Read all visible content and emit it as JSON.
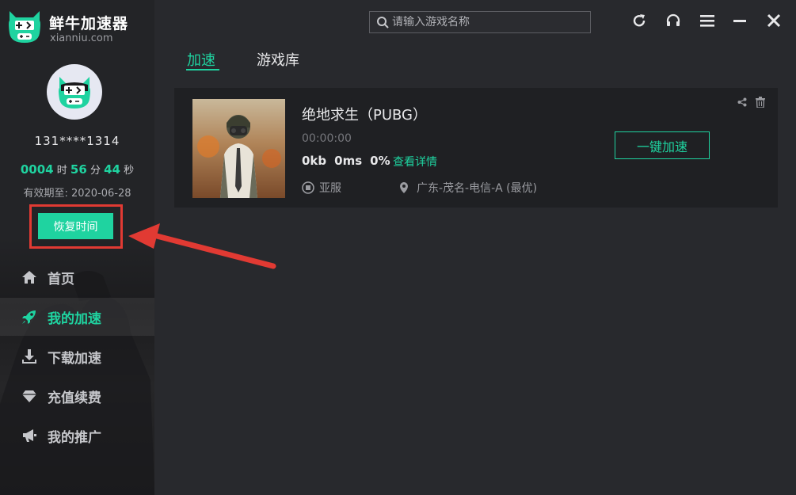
{
  "app": {
    "name": "鲜牛加速器",
    "site": "xianniu.com"
  },
  "user": {
    "id": "131****1314",
    "remaining": {
      "hours": "0004",
      "hours_unit": "时",
      "minutes": "56",
      "minutes_unit": "分",
      "seconds": "44",
      "seconds_unit": "秒"
    },
    "expiry": "有效期至: 2020-06-28",
    "restore_button": "恢复时间"
  },
  "nav": {
    "items": [
      {
        "label": "首页",
        "icon": "home-icon",
        "active": false
      },
      {
        "label": "我的加速",
        "icon": "rocket-icon",
        "active": true
      },
      {
        "label": "下载加速",
        "icon": "download-icon",
        "active": false
      },
      {
        "label": "充值续费",
        "icon": "diamond-icon",
        "active": false
      },
      {
        "label": "我的推广",
        "icon": "megaphone-icon",
        "active": false
      }
    ]
  },
  "header": {
    "search_placeholder": "请输入游戏名称",
    "window_buttons": [
      "refresh-icon",
      "headset-icon",
      "menu-icon",
      "minimize-icon",
      "close-icon"
    ]
  },
  "tabs": [
    {
      "label": "加速",
      "active": true
    },
    {
      "label": "游戏库",
      "active": false
    }
  ],
  "game_card": {
    "title": "绝地求生（PUBG）",
    "timer": "00:00:00",
    "speed": "0kb",
    "latency": "0ms",
    "loss": "0%",
    "details_link": "查看详情",
    "server": "亚服",
    "route": "广东-茂名-电信-A (最优)",
    "accelerate_button": "一键加速"
  },
  "colors": {
    "accent": "#1fd3a0",
    "highlight_box": "#e13a33",
    "background": "#28292d",
    "sidebar": "#232427",
    "card": "#1f2023"
  }
}
